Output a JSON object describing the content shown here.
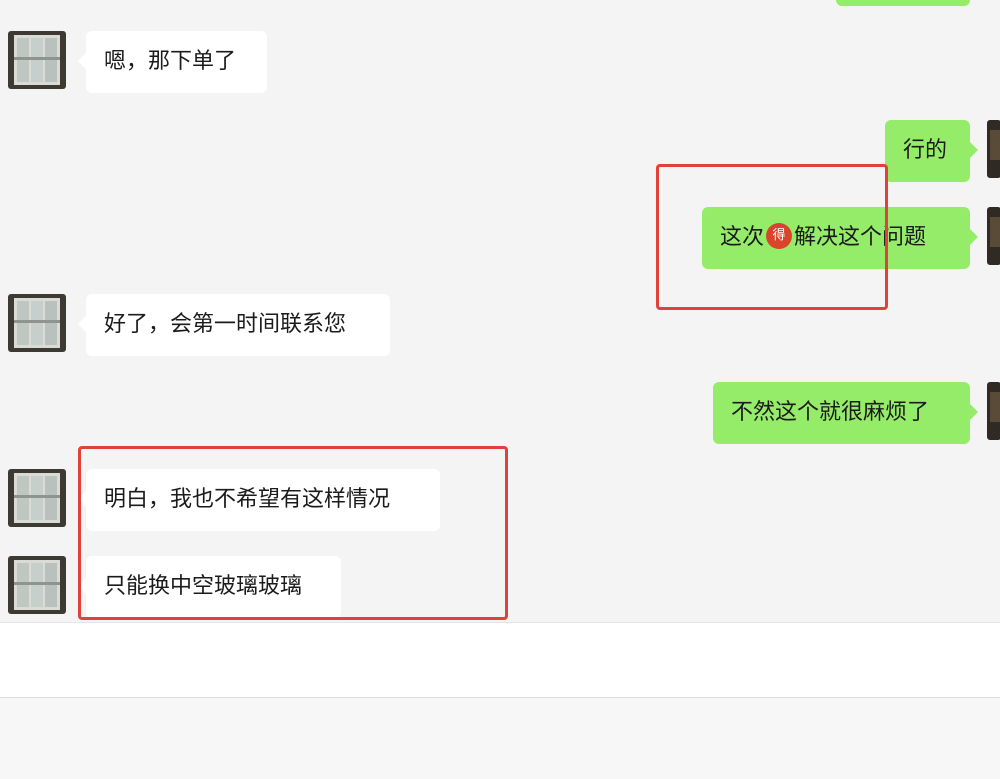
{
  "messages": [
    {
      "id": "m1",
      "side": "incoming",
      "text": "嗯，那下单了"
    },
    {
      "id": "m2",
      "side": "outgoing",
      "text": "行的"
    },
    {
      "id": "m3",
      "side": "outgoing",
      "text_before": "这次",
      "sticker_char": "得",
      "text_after": "解决这个问题"
    },
    {
      "id": "m4",
      "side": "incoming",
      "text": "好了，会第一时间联系您"
    },
    {
      "id": "m5",
      "side": "outgoing",
      "text": "不然这个就很麻烦了"
    },
    {
      "id": "m6",
      "side": "incoming",
      "text": "明白，我也不希望有这样情况"
    },
    {
      "id": "m7",
      "side": "incoming",
      "text": "只能换中空玻璃玻璃"
    }
  ],
  "icons": {
    "contact_avatar": "window-photo-avatar",
    "self_avatar": "dark-photo-avatar",
    "inline_sticker": "red-badge-emoji-icon"
  },
  "colors": {
    "incoming_bubble": "#ffffff",
    "outgoing_bubble": "#95ec69",
    "chat_background": "#f4f4f5",
    "annotation": "#e0413b"
  },
  "input": {
    "value": ""
  }
}
